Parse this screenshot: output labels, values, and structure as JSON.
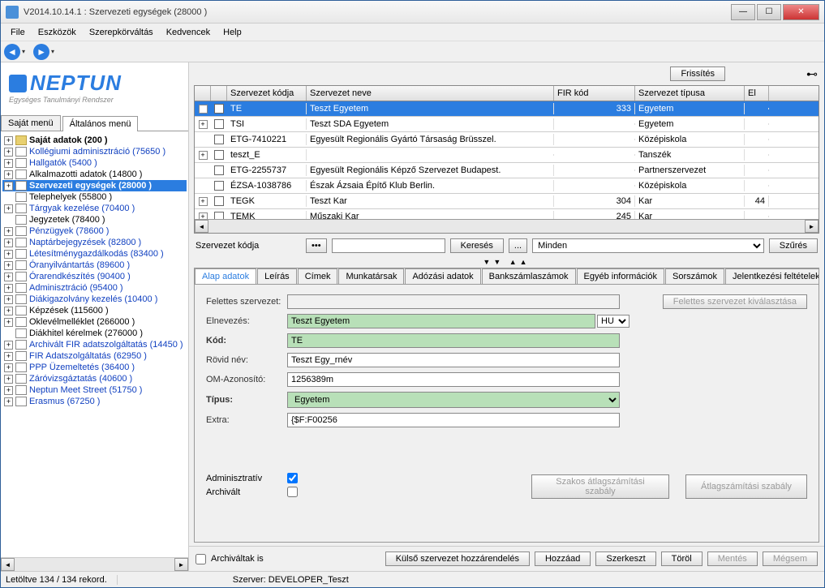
{
  "window": {
    "title": "V2014.10.14.1 : Szervezeti egységek (28000  )"
  },
  "menu": {
    "file": "File",
    "tools": "Eszközök",
    "role": "Szerepkörváltás",
    "fav": "Kedvencek",
    "help": "Help"
  },
  "logo": {
    "text": "NEPTUN",
    "sub": "Egységes Tanulmányi Rendszer"
  },
  "side_tabs": {
    "own": "Saját menü",
    "general": "Általános menü"
  },
  "tree": [
    {
      "label": "Saját adatok (200  )",
      "bold": true,
      "exp": "+",
      "icon": "fold"
    },
    {
      "label": "Kollégiumi adminisztráció (75650  )",
      "exp": "+",
      "icon": "doc"
    },
    {
      "label": "Hallgatók (5400  )",
      "exp": "+",
      "icon": "doc"
    },
    {
      "label": "Alkalmazotti adatok (14800  )",
      "exp": "+",
      "icon": "doc",
      "black": true
    },
    {
      "label": "Szervezeti egységek (28000  )",
      "exp": "+",
      "icon": "doc",
      "selected": true
    },
    {
      "label": "Telephelyek (55800  )",
      "exp": "",
      "icon": "doc",
      "black": true
    },
    {
      "label": "Tárgyak kezelése (70400  )",
      "exp": "+",
      "icon": "doc"
    },
    {
      "label": "Jegyzetek (78400  )",
      "exp": "",
      "icon": "doc",
      "black": true
    },
    {
      "label": "Pénzügyek (78600  )",
      "exp": "+",
      "icon": "doc"
    },
    {
      "label": "Naptárbejegyzések (82800  )",
      "exp": "+",
      "icon": "doc"
    },
    {
      "label": "Létesítménygazdálkodás (83400  )",
      "exp": "+",
      "icon": "doc"
    },
    {
      "label": "Óranyilvántartás (89600  )",
      "exp": "+",
      "icon": "doc"
    },
    {
      "label": "Órarendkészítés (90400  )",
      "exp": "+",
      "icon": "doc"
    },
    {
      "label": "Adminisztráció (95400  )",
      "exp": "+",
      "icon": "doc"
    },
    {
      "label": "Diákigazolvány kezelés (10400  )",
      "exp": "+",
      "icon": "doc"
    },
    {
      "label": "Képzések (115600  )",
      "exp": "+",
      "icon": "doc",
      "black": true
    },
    {
      "label": "Oklevélmelléklet (266000  )",
      "exp": "+",
      "icon": "doc",
      "black": true
    },
    {
      "label": "Diákhitel kérelmek (276000  )",
      "exp": "",
      "icon": "doc",
      "black": true
    },
    {
      "label": "Archivált FIR adatszolgáltatás (14450  )",
      "exp": "+",
      "icon": "doc"
    },
    {
      "label": "FIR Adatszolgáltatás (62950  )",
      "exp": "+",
      "icon": "doc"
    },
    {
      "label": "PPP Üzemeltetés (36400  )",
      "exp": "+",
      "icon": "doc"
    },
    {
      "label": "Záróvizsgáztatás (40600  )",
      "exp": "+",
      "icon": "doc"
    },
    {
      "label": "Neptun Meet Street (51750  )",
      "exp": "+",
      "icon": "doc"
    },
    {
      "label": "Erasmus (67250  )",
      "exp": "+",
      "icon": "doc"
    }
  ],
  "top_actions": {
    "refresh": "Frissítés"
  },
  "grid": {
    "cols": {
      "code": "Szervezet kódja",
      "name": "Szervezet neve",
      "fir": "FIR kód",
      "type": "Szervezet típusa",
      "e": "El"
    },
    "rows": [
      {
        "exp": "-",
        "code": "TE",
        "name": "Teszt Egyetem",
        "fir": "333",
        "type": "Egyetem",
        "e": "",
        "sel": true
      },
      {
        "exp": "+",
        "code": "TSI",
        "name": "Teszt SDA Egyetem",
        "fir": "",
        "type": "Egyetem",
        "e": ""
      },
      {
        "exp": "",
        "code": "ETG-7410221",
        "name": "Egyesült Regionális Gyártó Társaság Brüsszel.",
        "fir": "",
        "type": "Középiskola",
        "e": ""
      },
      {
        "exp": "+",
        "code": "teszt_E",
        "name": "",
        "fir": "",
        "type": "Tanszék",
        "e": ""
      },
      {
        "exp": "",
        "code": "ETG-2255737",
        "name": "Egyesült Regionális Képző Szervezet Budapest.",
        "fir": "",
        "type": "Partnerszervezet",
        "e": ""
      },
      {
        "exp": "",
        "code": "ÉZSA-1038786",
        "name": "Észak Ázsaia Építő Klub Berlin.",
        "fir": "",
        "type": "Középiskola",
        "e": ""
      },
      {
        "exp": "+",
        "code": "TEGK",
        "name": "Teszt Kar",
        "fir": "304",
        "type": "Kar",
        "e": "44"
      },
      {
        "exp": "+",
        "code": "TEMK",
        "name": "Műszaki Kar",
        "fir": "245",
        "type": "Kar",
        "e": ""
      }
    ]
  },
  "search": {
    "label": "Szervezet kódja",
    "value": "",
    "btn": "Keresés",
    "browse": "...",
    "filter_sel": "Minden",
    "filter_btn": "Szűrés"
  },
  "detail_tabs": [
    "Alap adatok",
    "Leírás",
    "Címek",
    "Munkatársak",
    "Adózási adatok",
    "Bankszámlaszámok",
    "Egyéb információk",
    "Sorszámok",
    "Jelentkezési feltételek"
  ],
  "form": {
    "parent_lbl": "Felettes szervezet:",
    "parent_val": "",
    "parent_btn": "Felettes szervezet kiválasztása",
    "name_lbl": "Elnevezés:",
    "name_val": "Teszt Egyetem",
    "lang": "HU",
    "code_lbl": "Kód:",
    "code_val": "TE",
    "short_lbl": "Rövid név:",
    "short_val": "Teszt Egy_rnév",
    "om_lbl": "OM-Azonosító:",
    "om_val": "1256389m",
    "type_lbl": "Típus:",
    "type_val": "Egyetem",
    "extra_lbl": "Extra:",
    "extra_val": "{$F:F00256",
    "admin_lbl": "Adminisztratív",
    "admin_chk": true,
    "arch_lbl": "Archivált",
    "arch_chk": false,
    "rule1_btn": "Szakos átlagszámítási szabály",
    "rule2_btn": "Átlagszámítási szabály"
  },
  "bottom": {
    "archived_lbl": "Archiváltak is",
    "assign": "Külső szervezet hozzárendelés",
    "add": "Hozzáad",
    "edit": "Szerkeszt",
    "del": "Töröl",
    "save": "Mentés",
    "cancel": "Mégsem"
  },
  "status": {
    "records": "Letöltve 134 / 134 rekord.",
    "server": "Szerver: DEVELOPER_Teszt"
  }
}
